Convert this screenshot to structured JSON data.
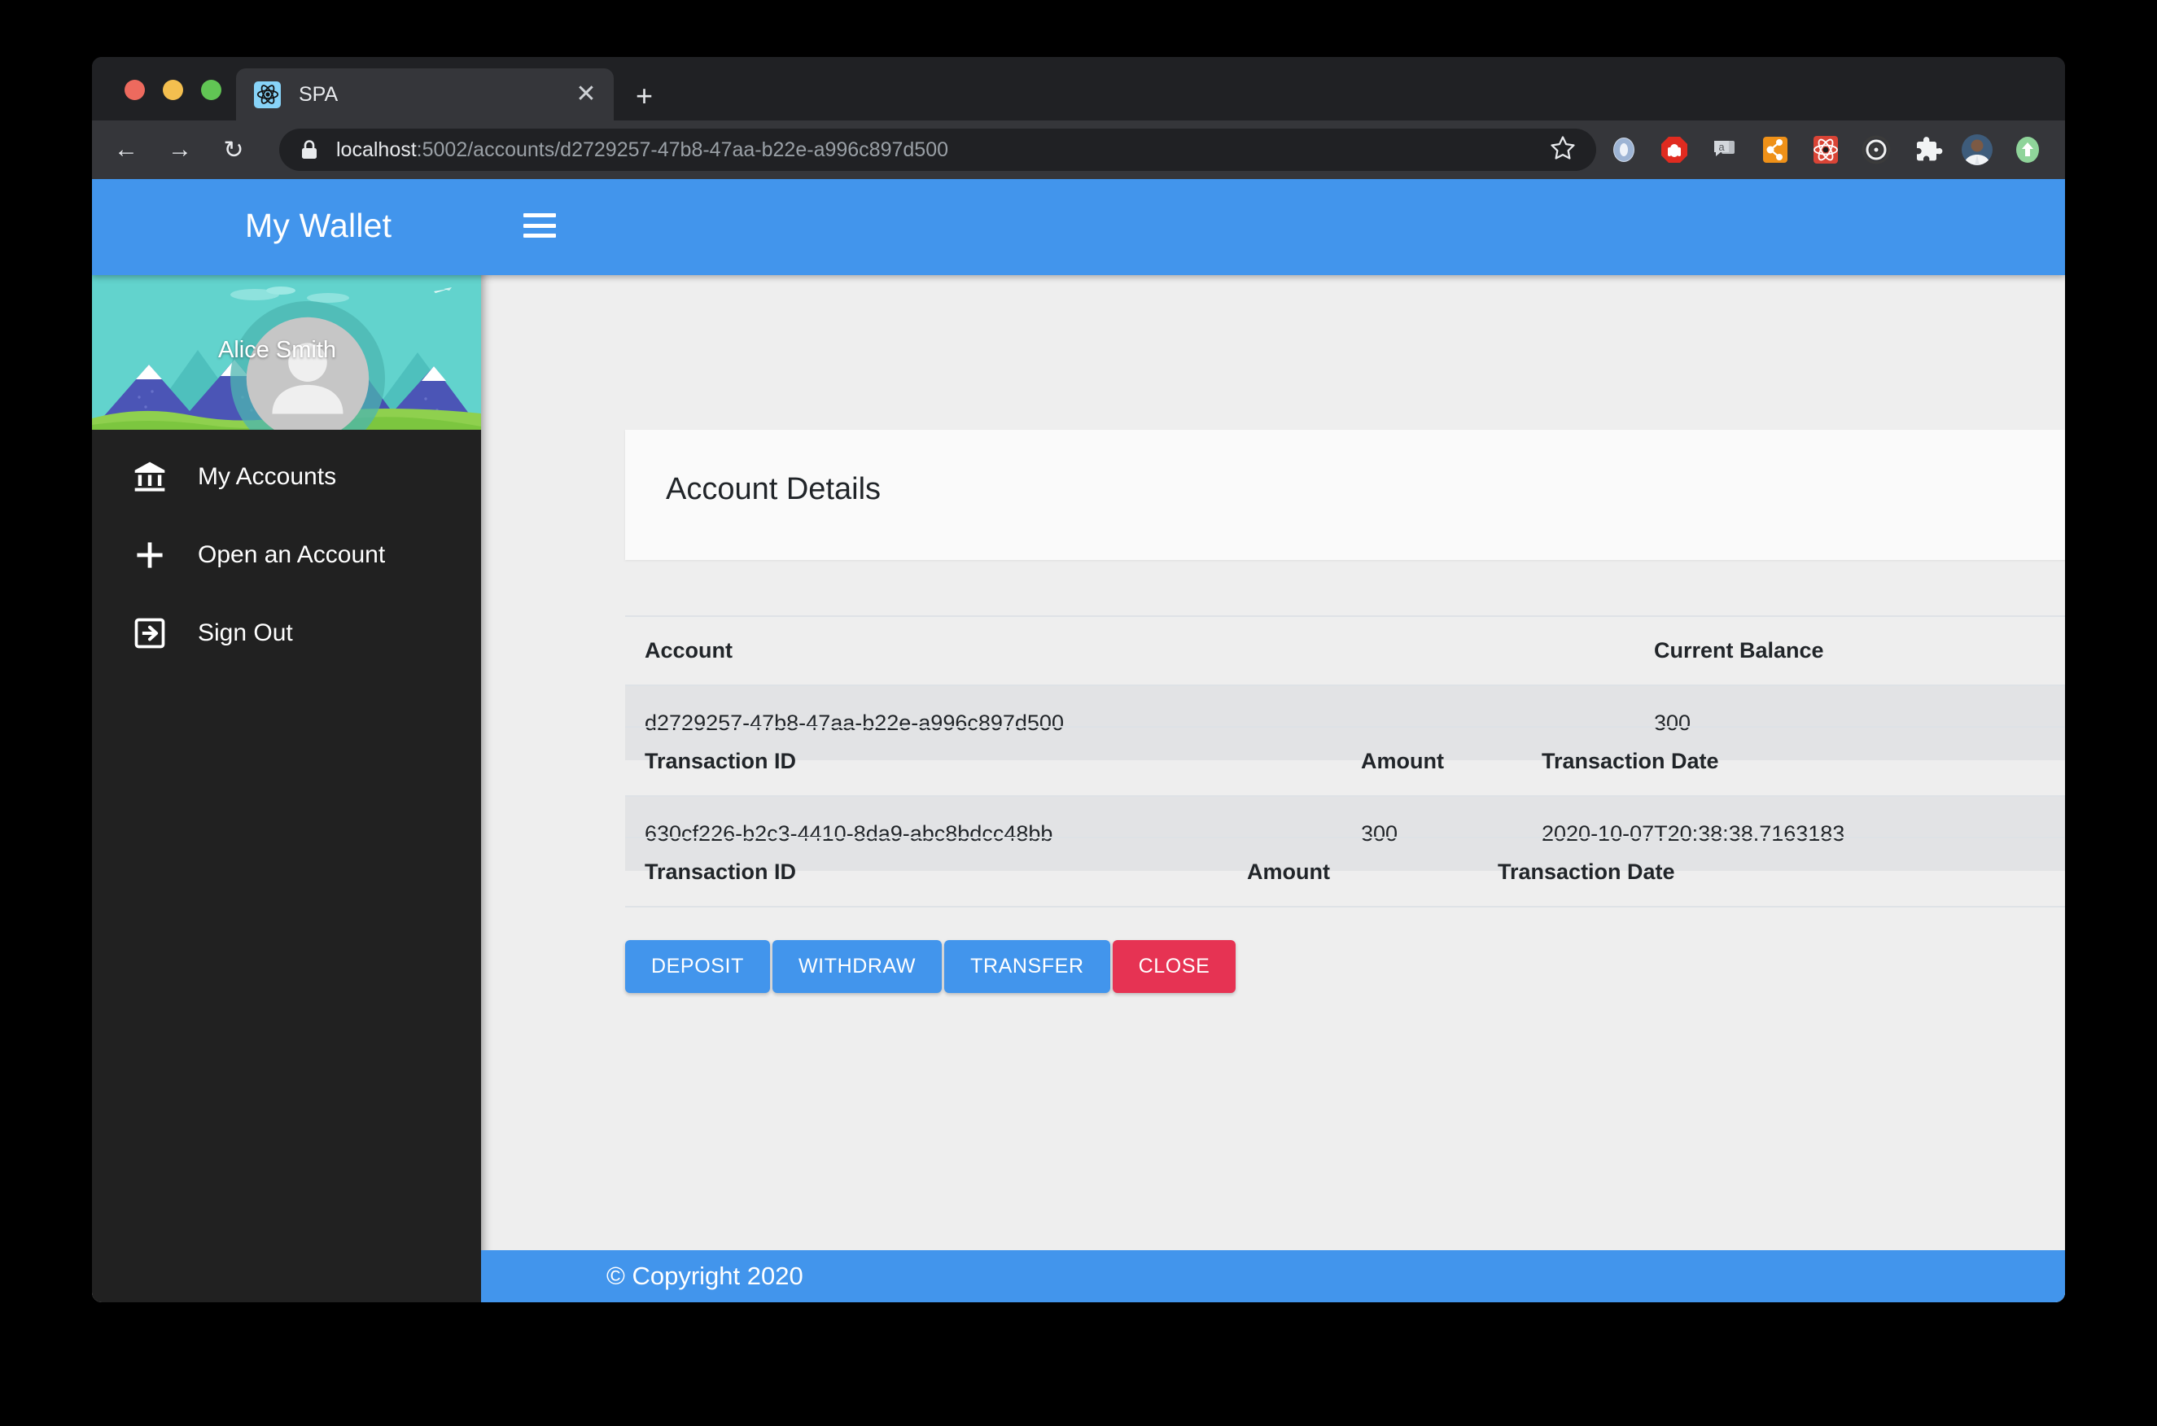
{
  "browser": {
    "tab": {
      "title": "SPA",
      "favicon_icon": "react-logo-icon",
      "close_icon": "close-icon"
    },
    "new_tab_icon": "plus-icon",
    "back_icon": "back-arrow-icon",
    "forward_icon": "forward-arrow-icon",
    "reload_icon": "reload-icon",
    "lock_icon": "lock-icon",
    "bookmark_icon": "star-icon",
    "url_host": "localhost",
    "url_path": ":5002/accounts/d2729257-47b8-47aa-b22e-a996c897d500",
    "url_full": "localhost:5002/accounts/d2729257-47b8-47aa-b22e-a996c897d500",
    "extensions": [
      {
        "name": "ring-extension-icon"
      },
      {
        "name": "adblock-stop-hand-icon"
      },
      {
        "name": "grammar-comment-icon"
      },
      {
        "name": "orange-share-icon"
      },
      {
        "name": "react-devtools-icon"
      },
      {
        "name": "target-rings-icon"
      },
      {
        "name": "puzzle-piece-icon"
      },
      {
        "name": "profile-avatar-icon"
      },
      {
        "name": "green-upload-icon"
      }
    ]
  },
  "appbar": {
    "brand": "My Wallet",
    "menu_icon": "hamburger-menu-icon",
    "color": "#4295ec"
  },
  "sidebar": {
    "profile": {
      "name": "Alice Smith",
      "avatar_icon": "person-avatar-icon"
    },
    "items": [
      {
        "label": "My Accounts",
        "icon": "bank-icon"
      },
      {
        "label": "Open an Account",
        "icon": "plus-icon"
      },
      {
        "label": "Sign Out",
        "icon": "exit-to-app-icon"
      }
    ]
  },
  "main": {
    "card_title": "Account Details",
    "account_table": {
      "headers": [
        "Account",
        "Current Balance"
      ],
      "rows": [
        [
          "d2729257-47b8-47aa-b22e-a996c897d500",
          "300"
        ]
      ]
    },
    "transactions_table": {
      "headers": [
        "Transaction ID",
        "Amount",
        "Transaction Date"
      ],
      "rows": [
        [
          "630cf226-b2c3-4410-8da9-abc8bdcc48bb",
          "300",
          "2020-10-07T20:38:38.7163183"
        ]
      ]
    },
    "transactions_empty_table": {
      "headers": [
        "Transaction ID",
        "Amount",
        "Transaction Date"
      ],
      "rows": []
    },
    "actions": [
      {
        "label": "DEPOSIT",
        "style": "primary",
        "color": "#4295ec"
      },
      {
        "label": "WITHDRAW",
        "style": "primary",
        "color": "#4295ec"
      },
      {
        "label": "TRANSFER",
        "style": "primary",
        "color": "#4295ec"
      },
      {
        "label": "CLOSE",
        "style": "danger",
        "color": "#e63353"
      }
    ]
  },
  "footer": {
    "text": "© Copyright 2020"
  }
}
